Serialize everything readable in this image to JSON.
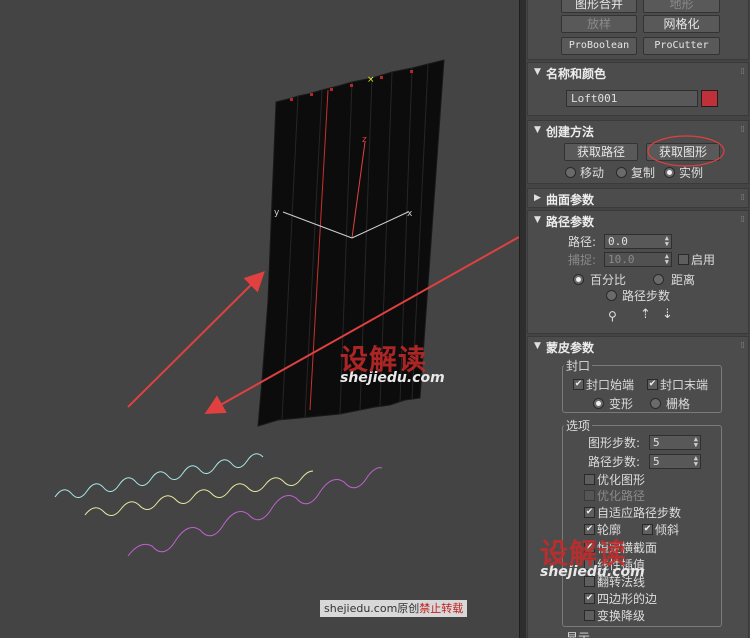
{
  "viewport": {
    "axis_x": "x",
    "axis_y": "y",
    "axis_z": "z",
    "watermark_logo": "设解读",
    "watermark_url": "shejiedu.com",
    "credit_site": "shejiedu.com原创",
    "credit_note": "禁止转载",
    "colors": {
      "shape_cyan": "#a8e8e8",
      "shape_yellow": "#e8e8a0",
      "shape_magenta": "#c060d0",
      "arrow": "#e04040"
    }
  },
  "top_buttons": {
    "merge": "图形合并",
    "terrain": "地形",
    "loft": "放样",
    "mesher": "网格化",
    "proboolean": "ProBoolean",
    "procutter": "ProCutter"
  },
  "name_color": {
    "title": "名称和颜色",
    "object_name": "Loft001",
    "color": "#c0303a"
  },
  "creation_method": {
    "title": "创建方法",
    "get_path": "获取路径",
    "get_shape": "获取图形",
    "move": "移动",
    "copy": "复制",
    "instance": "实例"
  },
  "surface_params": {
    "title": "曲面参数"
  },
  "path_params": {
    "title": "路径参数",
    "path_label": "路径:",
    "path_value": "0.0",
    "snap_label": "捕捉:",
    "snap_value": "10.0",
    "enable": "启用",
    "percentage": "百分比",
    "distance": "距离",
    "path_steps": "路径步数"
  },
  "skin_params": {
    "title": "蒙皮参数",
    "capping_title": "封口",
    "cap_start": "封口始端",
    "cap_end": "封口末端",
    "morph": "变形",
    "grid": "栅格",
    "options_title": "选项",
    "shape_steps_label": "图形步数:",
    "shape_steps_value": "5",
    "path_steps_label": "路径步数:",
    "path_steps_value": "5",
    "optimize_shapes": "优化图形",
    "optimize_path": "优化路径",
    "adaptive_path_steps": "自适应路径步数",
    "contour": "轮廓",
    "banking": "倾斜",
    "constant_cross_section": "恒定横截面",
    "linear_interpolation": "线性插值",
    "flip_normals": "翻转法线",
    "quad_sides": "四边形的边",
    "transform_degrade": "变换降级",
    "display_title": "显示"
  }
}
